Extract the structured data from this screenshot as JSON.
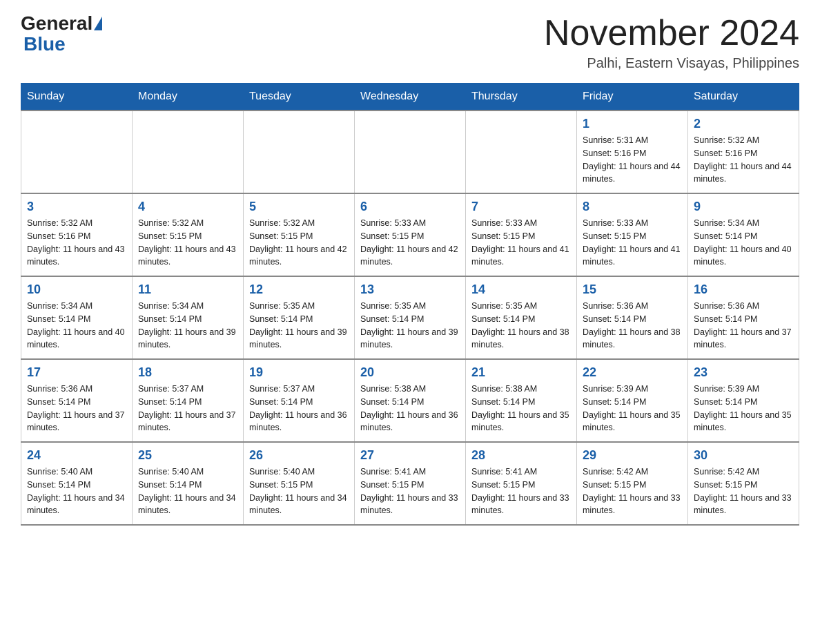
{
  "header": {
    "logo_general": "General",
    "logo_blue": "Blue",
    "month_title": "November 2024",
    "location": "Palhi, Eastern Visayas, Philippines"
  },
  "weekdays": [
    "Sunday",
    "Monday",
    "Tuesday",
    "Wednesday",
    "Thursday",
    "Friday",
    "Saturday"
  ],
  "weeks": [
    [
      {
        "day": "",
        "info": ""
      },
      {
        "day": "",
        "info": ""
      },
      {
        "day": "",
        "info": ""
      },
      {
        "day": "",
        "info": ""
      },
      {
        "day": "",
        "info": ""
      },
      {
        "day": "1",
        "info": "Sunrise: 5:31 AM\nSunset: 5:16 PM\nDaylight: 11 hours and 44 minutes."
      },
      {
        "day": "2",
        "info": "Sunrise: 5:32 AM\nSunset: 5:16 PM\nDaylight: 11 hours and 44 minutes."
      }
    ],
    [
      {
        "day": "3",
        "info": "Sunrise: 5:32 AM\nSunset: 5:16 PM\nDaylight: 11 hours and 43 minutes."
      },
      {
        "day": "4",
        "info": "Sunrise: 5:32 AM\nSunset: 5:15 PM\nDaylight: 11 hours and 43 minutes."
      },
      {
        "day": "5",
        "info": "Sunrise: 5:32 AM\nSunset: 5:15 PM\nDaylight: 11 hours and 42 minutes."
      },
      {
        "day": "6",
        "info": "Sunrise: 5:33 AM\nSunset: 5:15 PM\nDaylight: 11 hours and 42 minutes."
      },
      {
        "day": "7",
        "info": "Sunrise: 5:33 AM\nSunset: 5:15 PM\nDaylight: 11 hours and 41 minutes."
      },
      {
        "day": "8",
        "info": "Sunrise: 5:33 AM\nSunset: 5:15 PM\nDaylight: 11 hours and 41 minutes."
      },
      {
        "day": "9",
        "info": "Sunrise: 5:34 AM\nSunset: 5:14 PM\nDaylight: 11 hours and 40 minutes."
      }
    ],
    [
      {
        "day": "10",
        "info": "Sunrise: 5:34 AM\nSunset: 5:14 PM\nDaylight: 11 hours and 40 minutes."
      },
      {
        "day": "11",
        "info": "Sunrise: 5:34 AM\nSunset: 5:14 PM\nDaylight: 11 hours and 39 minutes."
      },
      {
        "day": "12",
        "info": "Sunrise: 5:35 AM\nSunset: 5:14 PM\nDaylight: 11 hours and 39 minutes."
      },
      {
        "day": "13",
        "info": "Sunrise: 5:35 AM\nSunset: 5:14 PM\nDaylight: 11 hours and 39 minutes."
      },
      {
        "day": "14",
        "info": "Sunrise: 5:35 AM\nSunset: 5:14 PM\nDaylight: 11 hours and 38 minutes."
      },
      {
        "day": "15",
        "info": "Sunrise: 5:36 AM\nSunset: 5:14 PM\nDaylight: 11 hours and 38 minutes."
      },
      {
        "day": "16",
        "info": "Sunrise: 5:36 AM\nSunset: 5:14 PM\nDaylight: 11 hours and 37 minutes."
      }
    ],
    [
      {
        "day": "17",
        "info": "Sunrise: 5:36 AM\nSunset: 5:14 PM\nDaylight: 11 hours and 37 minutes."
      },
      {
        "day": "18",
        "info": "Sunrise: 5:37 AM\nSunset: 5:14 PM\nDaylight: 11 hours and 37 minutes."
      },
      {
        "day": "19",
        "info": "Sunrise: 5:37 AM\nSunset: 5:14 PM\nDaylight: 11 hours and 36 minutes."
      },
      {
        "day": "20",
        "info": "Sunrise: 5:38 AM\nSunset: 5:14 PM\nDaylight: 11 hours and 36 minutes."
      },
      {
        "day": "21",
        "info": "Sunrise: 5:38 AM\nSunset: 5:14 PM\nDaylight: 11 hours and 35 minutes."
      },
      {
        "day": "22",
        "info": "Sunrise: 5:39 AM\nSunset: 5:14 PM\nDaylight: 11 hours and 35 minutes."
      },
      {
        "day": "23",
        "info": "Sunrise: 5:39 AM\nSunset: 5:14 PM\nDaylight: 11 hours and 35 minutes."
      }
    ],
    [
      {
        "day": "24",
        "info": "Sunrise: 5:40 AM\nSunset: 5:14 PM\nDaylight: 11 hours and 34 minutes."
      },
      {
        "day": "25",
        "info": "Sunrise: 5:40 AM\nSunset: 5:14 PM\nDaylight: 11 hours and 34 minutes."
      },
      {
        "day": "26",
        "info": "Sunrise: 5:40 AM\nSunset: 5:15 PM\nDaylight: 11 hours and 34 minutes."
      },
      {
        "day": "27",
        "info": "Sunrise: 5:41 AM\nSunset: 5:15 PM\nDaylight: 11 hours and 33 minutes."
      },
      {
        "day": "28",
        "info": "Sunrise: 5:41 AM\nSunset: 5:15 PM\nDaylight: 11 hours and 33 minutes."
      },
      {
        "day": "29",
        "info": "Sunrise: 5:42 AM\nSunset: 5:15 PM\nDaylight: 11 hours and 33 minutes."
      },
      {
        "day": "30",
        "info": "Sunrise: 5:42 AM\nSunset: 5:15 PM\nDaylight: 11 hours and 33 minutes."
      }
    ]
  ]
}
